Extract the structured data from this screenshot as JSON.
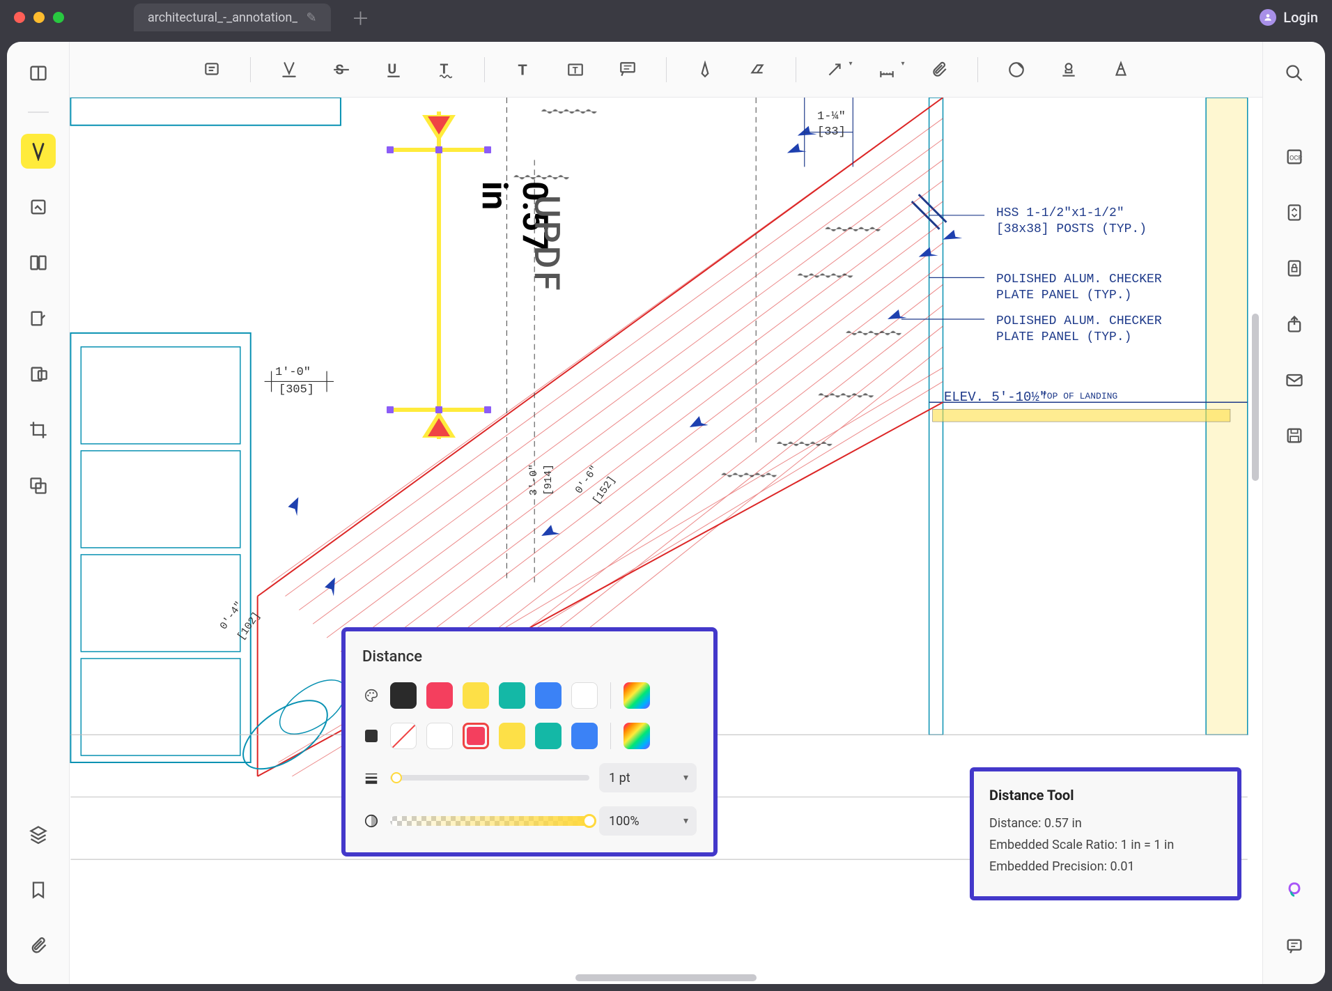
{
  "titlebar": {
    "tab_title": "architectural_-_annotation_",
    "login_label": "Login"
  },
  "canvas": {
    "measurement": {
      "value_label": "0.57 in",
      "watermark": "UPDF"
    },
    "callouts": {
      "hss": "HSS 1-1/2\"x1-1/2\"\n[38x38] POSTS (TYP.)",
      "panel1": "POLISHED ALUM. CHECKER\nPLATE PANEL (TYP.)",
      "panel2": "POLISHED ALUM. CHECKER\nPLATE PANEL (TYP.)",
      "elev": "ELEV. 5'-10½\"",
      "elev_note": "TOP OF LANDING"
    },
    "dimensions": {
      "d1_ft": "1-¼\"",
      "d1_mm": "[33]",
      "d2_ft": "1'-0\"",
      "d2_mm": "[305]",
      "d3_ft": "3'-0\"",
      "d3_mm": "[914]",
      "d4_ft": "0'-6\"",
      "d4_mm": "[152]",
      "d5_ft": "0'-4\"",
      "d5_mm": "[102]"
    }
  },
  "distance_panel": {
    "title": "Distance",
    "stroke_colors": [
      "#2a2a2a",
      "#f43f5e",
      "#fde047",
      "#14b8a6",
      "#3b82f6",
      "#ffffff"
    ],
    "fill_colors": [
      "none",
      "#ffffff",
      "#f43f5e",
      "#fde047",
      "#14b8a6",
      "#3b82f6"
    ],
    "stroke_selected_index": -1,
    "fill_selected_index": 2,
    "thickness_label": "1 pt",
    "thickness_slider_pct": 3,
    "opacity_label": "100%",
    "opacity_slider_pct": 100
  },
  "tooltip": {
    "title": "Distance Tool",
    "distance_label": "Distance: 0.57 in",
    "scale_label": "Embedded Scale Ratio: 1 in = 1 in",
    "precision_label": "Embedded Precision: 0.01"
  }
}
